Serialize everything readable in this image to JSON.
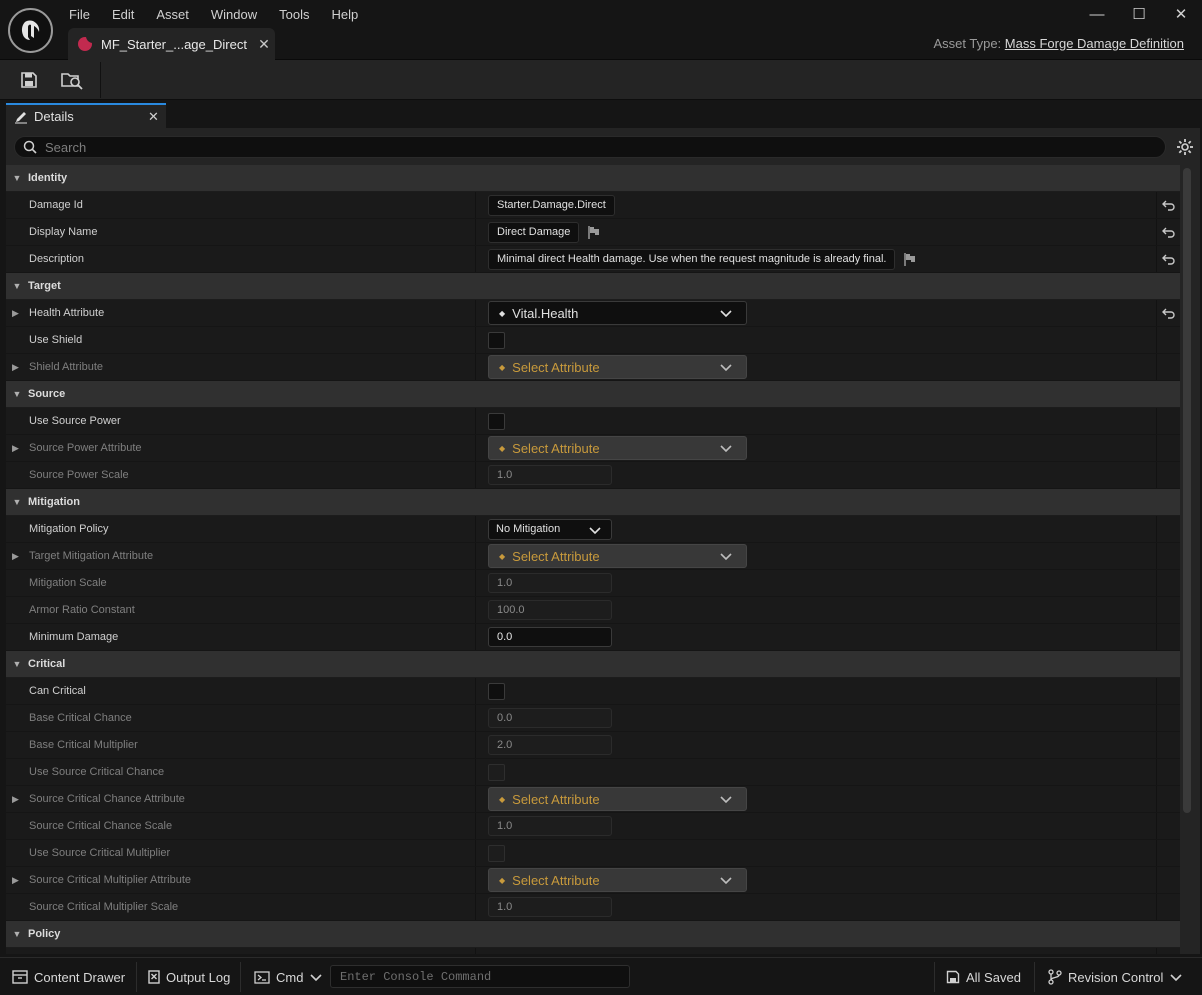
{
  "menu": [
    "File",
    "Edit",
    "Asset",
    "Window",
    "Tools",
    "Help"
  ],
  "window_controls": {
    "minimize": "—",
    "maximize": "☐",
    "close": "✕"
  },
  "doc_tab": {
    "label": "MF_Starter_...age_Direct",
    "close": "✕"
  },
  "asset_type": {
    "label": "Asset Type:",
    "value": "Mass Forge Damage Definition"
  },
  "details_tab": {
    "label": "Details",
    "close": "✕"
  },
  "search": {
    "placeholder": "Search"
  },
  "categories": {
    "identity": "Identity",
    "target": "Target",
    "source": "Source",
    "mitigation": "Mitigation",
    "critical": "Critical",
    "policy": "Policy"
  },
  "props": {
    "damage_id": {
      "name": "Damage Id",
      "value": "Starter.Damage.Direct"
    },
    "display_name": {
      "name": "Display Name",
      "value": "Direct Damage"
    },
    "description": {
      "name": "Description",
      "value": "Minimal direct Health damage. Use when the request magnitude is already final."
    },
    "health_attribute": {
      "name": "Health Attribute",
      "value": "Vital.Health"
    },
    "use_shield": {
      "name": "Use Shield"
    },
    "shield_attribute": {
      "name": "Shield Attribute",
      "value": "Select Attribute"
    },
    "use_source_power": {
      "name": "Use Source Power"
    },
    "source_power_attribute": {
      "name": "Source Power Attribute",
      "value": "Select Attribute"
    },
    "source_power_scale": {
      "name": "Source Power Scale",
      "value": "1.0"
    },
    "mitigation_policy": {
      "name": "Mitigation Policy",
      "value": "No Mitigation"
    },
    "target_mitigation_attribute": {
      "name": "Target Mitigation Attribute",
      "value": "Select Attribute"
    },
    "mitigation_scale": {
      "name": "Mitigation Scale",
      "value": "1.0"
    },
    "armor_ratio_constant": {
      "name": "Armor Ratio Constant",
      "value": "100.0"
    },
    "minimum_damage": {
      "name": "Minimum Damage",
      "value": "0.0"
    },
    "can_critical": {
      "name": "Can Critical"
    },
    "base_critical_chance": {
      "name": "Base Critical Chance",
      "value": "0.0"
    },
    "base_critical_multiplier": {
      "name": "Base Critical Multiplier",
      "value": "2.0"
    },
    "use_source_critical_chance": {
      "name": "Use Source Critical Chance"
    },
    "source_critical_chance_attribute": {
      "name": "Source Critical Chance Attribute",
      "value": "Select Attribute"
    },
    "source_critical_chance_scale": {
      "name": "Source Critical Chance Scale",
      "value": "1.0"
    },
    "use_source_critical_multiplier": {
      "name": "Use Source Critical Multiplier"
    },
    "source_critical_multiplier_attribute": {
      "name": "Source Critical Multiplier Attribute",
      "value": "Select Attribute"
    },
    "source_critical_multiplier_scale": {
      "name": "Source Critical Multiplier Scale",
      "value": "1.0"
    }
  },
  "statusbar": {
    "content_drawer": "Content Drawer",
    "output_log": "Output Log",
    "cmd": "Cmd",
    "console_placeholder": "Enter Console Command",
    "all_saved": "All Saved",
    "revision_control": "Revision Control"
  },
  "colors": {
    "accent": "#2a8ae0",
    "asset_icon": "#c22a4f",
    "select_attribute_text": "#c89a3c"
  }
}
